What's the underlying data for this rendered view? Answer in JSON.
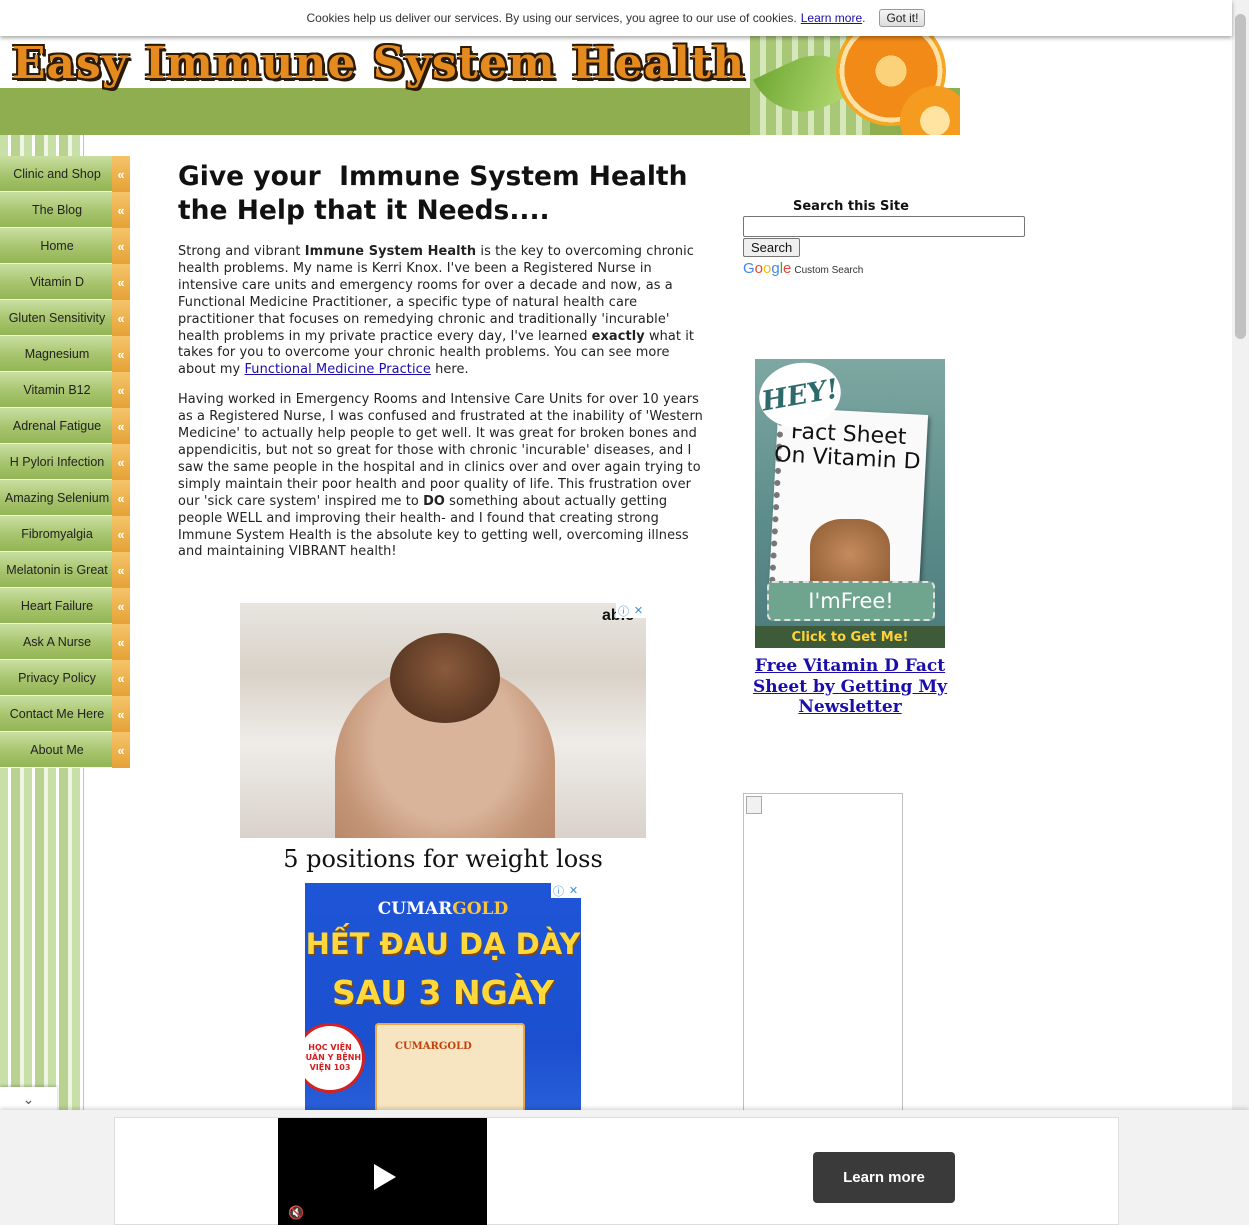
{
  "cookie_bar": {
    "message": "Cookies help us deliver our services. By using our services, you agree to our use of cookies.",
    "learn_more": "Learn more",
    "dot": ".",
    "got_it": "Got it!"
  },
  "header": {
    "site_title": "Easy Immune System Health"
  },
  "nav": {
    "items": [
      {
        "label": "Clinic and Shop"
      },
      {
        "label": "The Blog"
      },
      {
        "label": "Home"
      },
      {
        "label": "Vitamin D"
      },
      {
        "label": "Gluten Sensitivity"
      },
      {
        "label": "Magnesium"
      },
      {
        "label": "Vitamin B12"
      },
      {
        "label": "Adrenal Fatigue"
      },
      {
        "label": "H Pylori Infection"
      },
      {
        "label": "Amazing Selenium"
      },
      {
        "label": "Fibromyalgia"
      },
      {
        "label": "Melatonin is Great"
      },
      {
        "label": "Heart Failure"
      },
      {
        "label": "Ask A Nurse"
      },
      {
        "label": "Privacy Policy"
      },
      {
        "label": "Contact Me Here"
      },
      {
        "label": "About Me"
      }
    ],
    "chevron": "«"
  },
  "main": {
    "heading": "Give your  Immune System Health the Help that it Needs....",
    "p1": {
      "a": "Strong and vibrant ",
      "b": "Immune System Health",
      "c": " is the key to overcoming chronic health problems. My name is Kerri Knox. I've been a Registered Nurse in intensive care units and emergency rooms for over a decade and now, as a Functional Medicine Practitioner, a specific type of natural health care practitioner that focuses on remedying chronic and traditionally 'incurable' health problems in my private practice every day, I've learned ",
      "d": "exactly",
      "e": " what it takes for you to overcome your chronic health problems. You can see more about my ",
      "link": "Functional Medicine Practice",
      "f": " here."
    },
    "p2": {
      "a": "Having worked in Emergency Rooms and Intensive Care Units for over 10 years as a Registered Nurse, I was confused and frustrated at the inability of 'Western Medicine' to actually help people to get well.  It was great for broken bones and appendicitis, but not so great for those with chronic 'incurable' diseases, and I saw the same people in the hospital and in clinics over and over again trying to simply maintain their poor health and poor quality of life. This frustration over our 'sick care system' inspired me to ",
      "b": "DO",
      "c": " something about actually getting people WELL and improving their health- and I found that creating strong Immune System Health is the absolute key to getting well, overcoming illness and maintaining VIBRANT health!"
    }
  },
  "ad1": {
    "brand": "able",
    "caption": "5 positions for weight loss",
    "info": "ⓘ",
    "close": "✕"
  },
  "ad2": {
    "brand_a": "CUMAR",
    "brand_b": "GOLD",
    "line1": "HẾT ĐAU DẠ DÀY",
    "line2": "SAU 3 NGÀY",
    "box_text": "CUMARGOLD",
    "seal_text": "HỌC VIỆN QUÂN Y BỆNH VIỆN 103",
    "info": "ⓘ",
    "close": "✕"
  },
  "search": {
    "label": "Search this Site",
    "value": "",
    "button": "Search",
    "google": "Google",
    "custom": "Custom Search"
  },
  "promo": {
    "hey": "HEY!",
    "fact_sheet": "Fact Sheet On Vitamin D",
    "free": "I'mFree!",
    "click": "Click to Get Me!",
    "link": "Free Vitamin D Fact Sheet by Getting My Newsletter"
  },
  "bottom_ad": {
    "learn_more": "Learn more",
    "mute_icon": "🔇",
    "collapse": "⌄"
  },
  "colors": {
    "nav_green": "#a7c46d",
    "nav_chevron": "#e6a236",
    "link": "#1a0dab",
    "header_band": "#8fae50"
  }
}
